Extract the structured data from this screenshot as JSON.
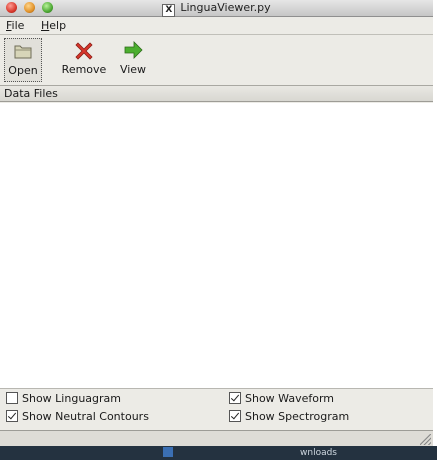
{
  "window": {
    "title": "LinguaViewer.py"
  },
  "menu": {
    "file": "File",
    "file_mnemonic": "F",
    "file_rest": "ile",
    "help": "Help",
    "help_mnemonic": "H",
    "help_rest": "elp"
  },
  "toolbar": {
    "open_label": "Open",
    "remove_label": "Remove",
    "view_label": "View",
    "icons": {
      "open": "folder-icon",
      "remove": "red-x-icon",
      "view": "green-arrow-icon"
    }
  },
  "list": {
    "header": "Data Files",
    "items": []
  },
  "options": {
    "show_linguagram": {
      "label": "Show Linguagram",
      "checked": false
    },
    "show_neutral_contours": {
      "label": "Show Neutral Contours",
      "checked": true
    },
    "show_waveform": {
      "label": "Show Waveform",
      "checked": true
    },
    "show_spectrogram": {
      "label": "Show Spectrogram",
      "checked": true
    }
  },
  "desktop": {
    "partial_text": "wnloads"
  },
  "colors": {
    "window_bg": "#ecebe6",
    "list_bg": "#ffffff",
    "remove_red": "#d8362c",
    "view_green": "#4caf2f"
  }
}
